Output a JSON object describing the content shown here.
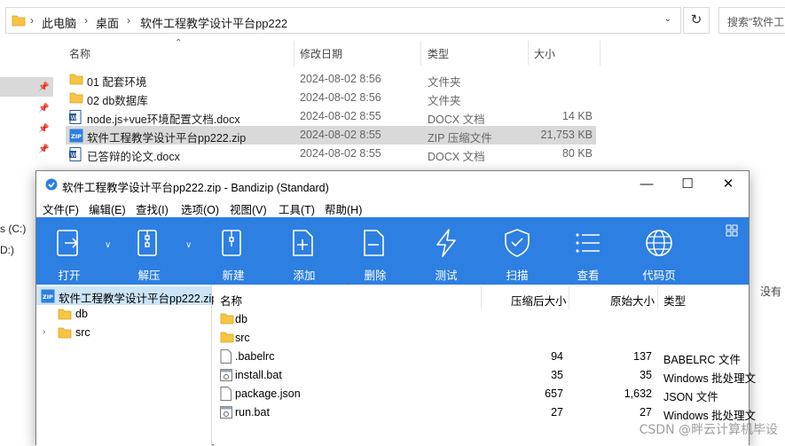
{
  "explorer": {
    "breadcrumb": [
      "此电脑",
      "桌面",
      "软件工程教学设计平台pp222"
    ],
    "search_placeholder": "搜索\"软件工",
    "columns": {
      "name": "名称",
      "date": "修改日期",
      "type": "类型",
      "size": "大小"
    },
    "nav": {
      "drive1": "s (C:)",
      "drive2": "D:)"
    },
    "files": [
      {
        "name": "01  配套环境",
        "date": "2024-08-02 8:56",
        "type": "文件夹",
        "size": "",
        "icon": "folder-icon",
        "selected": false
      },
      {
        "name": "02 db数据库",
        "date": "2024-08-02 8:56",
        "type": "文件夹",
        "size": "",
        "icon": "folder-icon",
        "selected": false
      },
      {
        "name": "node.js+vue环境配置文档.docx",
        "date": "2024-08-02 8:55",
        "type": "DOCX 文档",
        "size": "14 KB",
        "icon": "docx-icon",
        "selected": false
      },
      {
        "name": "软件工程教学设计平台pp222.zip",
        "date": "2024-08-02 8:55",
        "type": "ZIP 压缩文件",
        "size": "21,753 KB",
        "icon": "zip-icon",
        "selected": true
      },
      {
        "name": "已答辩的论文.docx",
        "date": "2024-08-02 8:55",
        "type": "DOCX 文档",
        "size": "80 KB",
        "icon": "docx-icon",
        "selected": false
      }
    ],
    "right_fragment": "没有"
  },
  "bandizip": {
    "title": "软件工程教学设计平台pp222.zip - Bandizip (Standard)",
    "menu": [
      "文件(F)",
      "编辑(E)",
      "查找(I)",
      "选项(O)",
      "视图(V)",
      "工具(T)",
      "帮助(H)"
    ],
    "toolbar": [
      {
        "label": "打开",
        "icon": "open-icon"
      },
      {
        "label": "解压",
        "icon": "extract-icon"
      },
      {
        "label": "新建",
        "icon": "new-archive-icon"
      },
      {
        "label": "添加",
        "icon": "add-icon"
      },
      {
        "label": "删除",
        "icon": "delete-icon"
      },
      {
        "label": "测试",
        "icon": "test-icon"
      },
      {
        "label": "扫描",
        "icon": "scan-shield-icon"
      },
      {
        "label": "查看",
        "icon": "view-list-icon"
      },
      {
        "label": "代码页",
        "icon": "codepage-globe-icon"
      }
    ],
    "tree": [
      {
        "label": "软件工程教学设计平台pp222.zip",
        "icon": "zip-icon"
      },
      {
        "label": "db",
        "icon": "folder-icon"
      },
      {
        "label": "src",
        "icon": "folder-icon"
      }
    ],
    "columns": {
      "name": "名称",
      "compressed": "压缩后大小",
      "original": "原始大小",
      "type": "类型"
    },
    "files": [
      {
        "name": "db",
        "compressed": "",
        "original": "",
        "type": "",
        "icon": "folder-icon"
      },
      {
        "name": "src",
        "compressed": "",
        "original": "",
        "type": "",
        "icon": "folder-icon"
      },
      {
        "name": ".babelrc",
        "compressed": "94",
        "original": "137",
        "type": "BABELRC 文件",
        "icon": "file-icon"
      },
      {
        "name": "install.bat",
        "compressed": "35",
        "original": "35",
        "type": "Windows 批处理文",
        "icon": "bat-icon"
      },
      {
        "name": "package.json",
        "compressed": "657",
        "original": "1,632",
        "type": "JSON 文件",
        "icon": "file-icon"
      },
      {
        "name": "run.bat",
        "compressed": "27",
        "original": "27",
        "type": "Windows 批处理文",
        "icon": "bat-icon"
      }
    ]
  },
  "watermark": "CSDN @畔云计算机毕设",
  "colors": {
    "toolbar": "#2d7fe2",
    "selection": "#cce4f7",
    "folder": "#f6c543"
  }
}
